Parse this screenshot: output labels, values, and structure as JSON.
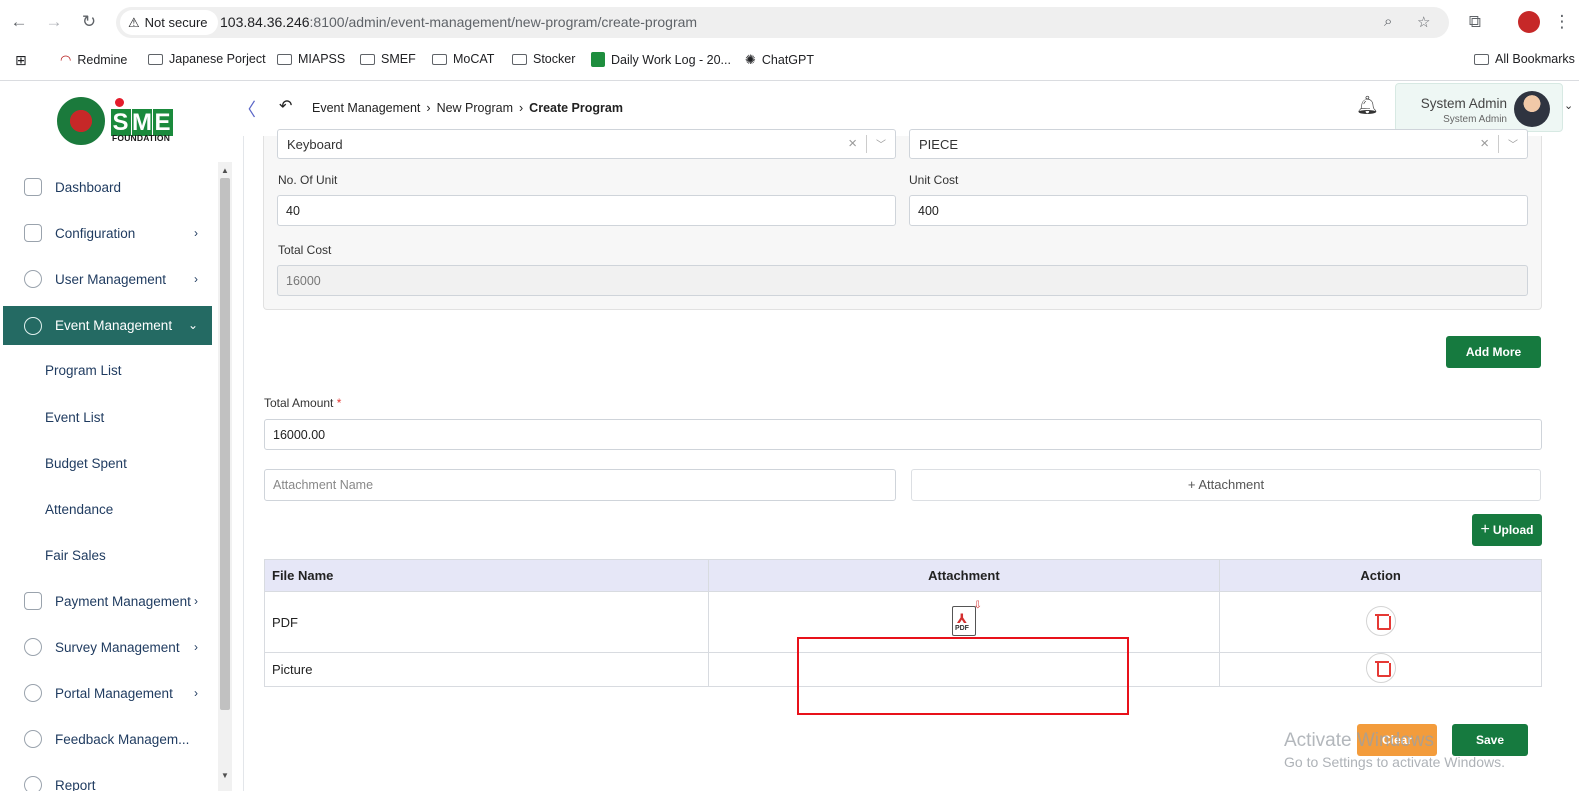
{
  "browser": {
    "security_label": "Not secure",
    "url_host": "103.84.36.246",
    "url_rest": ":8100/admin/event-management/new-program/create-program",
    "bookmarks": [
      "Redmine",
      "Japanese Porject",
      "MIAPSS",
      "SMEF",
      "MoCAT",
      "Stocker",
      "Daily Work Log - 20...",
      "ChatGPT"
    ],
    "all_bookmarks": "All Bookmarks"
  },
  "logo": {
    "letters": [
      "S",
      "M",
      "E"
    ],
    "foundation": "FOUNDATION",
    "colors": {
      "s": "#1a8a3c",
      "m": "#1a8a3c",
      "e": "#1a8a3c",
      "dot": "#e41c2b"
    }
  },
  "sidebar": {
    "items": [
      {
        "label": "Dashboard"
      },
      {
        "label": "Configuration"
      },
      {
        "label": "User Management"
      },
      {
        "label": "Event Management"
      },
      {
        "label": "Payment Management"
      },
      {
        "label": "Survey Management"
      },
      {
        "label": "Portal Management"
      },
      {
        "label": "Feedback Managem..."
      },
      {
        "label": "Report"
      }
    ],
    "submenu": [
      "Program List",
      "Event List",
      "Budget Spent",
      "Attendance",
      "Fair Sales"
    ],
    "active_color": "#246a63"
  },
  "header": {
    "breadcrumb": [
      "Event Management",
      "New Program",
      "Create Program"
    ],
    "user_name": "System Admin",
    "user_role": "System Admin"
  },
  "form": {
    "item_value": "Keyboard",
    "unit_type_value": "PIECE",
    "no_of_unit_label": "No. Of Unit",
    "no_of_unit_value": "40",
    "unit_cost_label": "Unit Cost",
    "unit_cost_value": "400",
    "total_cost_label": "Total Cost",
    "total_cost_value": "16000",
    "add_more_label": "Add More",
    "total_amount_label": "Total Amount",
    "total_amount_required": "*",
    "total_amount_value": "16000.00",
    "attachment_name_placeholder": "Attachment Name",
    "attachment_button_label": "+ Attachment",
    "upload_label": "Upload"
  },
  "table": {
    "headers": [
      "File Name",
      "Attachment",
      "Action"
    ],
    "rows": [
      {
        "file_name": "PDF",
        "attachment": "PDF"
      },
      {
        "file_name": "Picture",
        "attachment": ""
      }
    ]
  },
  "footer": {
    "clear_label": "Clear",
    "save_label": "Save"
  },
  "watermark": {
    "line1": "Activate Windows",
    "line2": "Go to Settings to activate Windows."
  },
  "colors": {
    "primary_green": "#167a3f",
    "clear_orange": "#f39c3c",
    "highlight_red": "#e8111a"
  }
}
